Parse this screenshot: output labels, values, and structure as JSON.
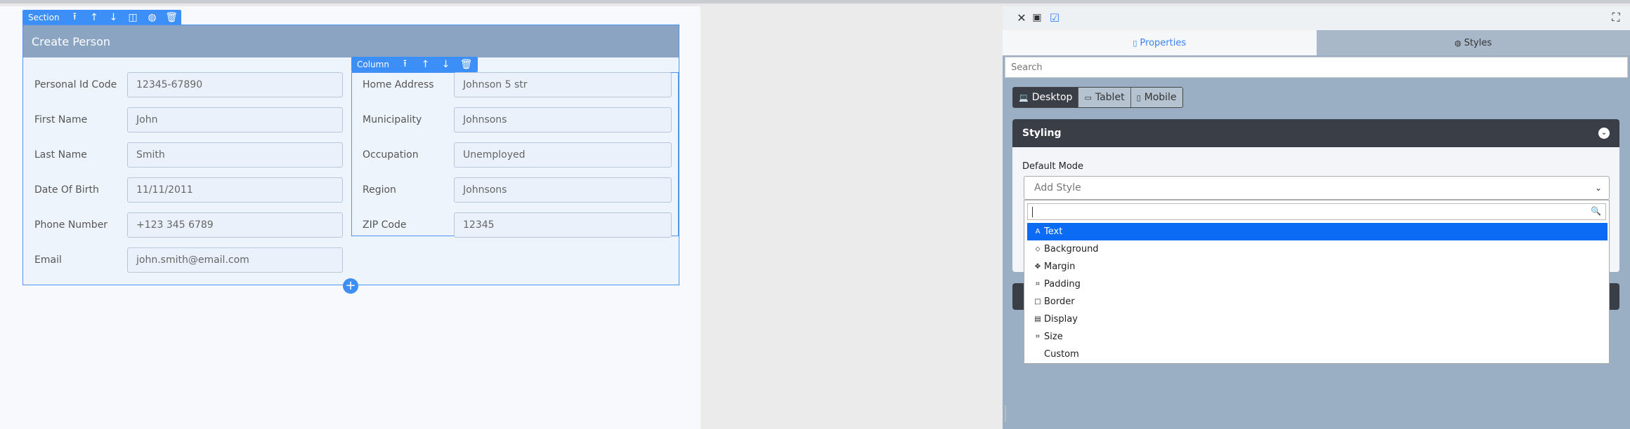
{
  "section_toolbar": {
    "label": "Section",
    "icons": [
      "move-up-icon",
      "arrow-up-icon",
      "arrow-down-icon",
      "columns-icon",
      "style-icon",
      "trash-icon"
    ]
  },
  "column_toolbar": {
    "label": "Column",
    "icons": [
      "move-up-icon",
      "arrow-up-icon",
      "arrow-down-icon",
      "trash-icon"
    ]
  },
  "form": {
    "title": "Create Person",
    "left": [
      {
        "label": "Personal Id Code",
        "value": "12345-67890"
      },
      {
        "label": "First Name",
        "value": "John"
      },
      {
        "label": "Last Name",
        "value": "Smith"
      },
      {
        "label": "Date Of Birth",
        "value": "11/11/2011"
      },
      {
        "label": "Phone Number",
        "value": "+123 345 6789"
      },
      {
        "label": "Email",
        "value": "john.smith@email.com"
      }
    ],
    "right": [
      {
        "label": "Home Address",
        "value": "Johnson 5 str"
      },
      {
        "label": "Municipality",
        "value": "Johnsons"
      },
      {
        "label": "Occupation",
        "value": "Unemployed"
      },
      {
        "label": "Region",
        "value": "Johnsons"
      },
      {
        "label": "ZIP Code",
        "value": "12345"
      }
    ],
    "add_symbol": "+"
  },
  "panel": {
    "tabs": {
      "properties": "Properties",
      "styles": "Styles"
    },
    "search_placeholder": "Search",
    "devices": [
      "Desktop",
      "Tablet",
      "Mobile"
    ],
    "active_device": "Desktop",
    "styling_title": "Styling",
    "default_mode_label": "Default Mode",
    "select_placeholder": "Add Style",
    "options": [
      "Text",
      "Background",
      "Margin",
      "Padding",
      "Border",
      "Display",
      "Size",
      "Custom"
    ],
    "selected_option": "Text"
  },
  "colors": {
    "accent": "#3b8ff7",
    "section_header": "#8aa4c2",
    "dark": "#3a3f47",
    "selected": "#0b6bf5"
  }
}
